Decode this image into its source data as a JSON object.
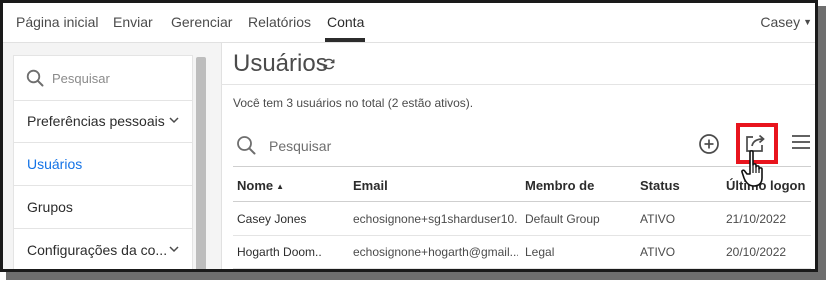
{
  "nav": {
    "items": [
      {
        "label": "Página inicial"
      },
      {
        "label": "Enviar"
      },
      {
        "label": "Gerenciar"
      },
      {
        "label": "Relatórios"
      },
      {
        "label": "Conta"
      }
    ],
    "active": "Conta",
    "user": "Casey"
  },
  "sidebar": {
    "search_placeholder": "Pesquisar",
    "items": [
      {
        "label": "Preferências pessoais",
        "icon": "chevron-down-icon"
      },
      {
        "label": "Usuários",
        "active": true
      },
      {
        "label": "Grupos"
      },
      {
        "label": "Configurações da co..."
      }
    ]
  },
  "main": {
    "title": "Usuários",
    "summary": "Você tem 3 usuários no total (2 estão ativos).",
    "search_placeholder": "Pesquisar",
    "table": {
      "columns": [
        "Nome",
        "Email",
        "Membro de",
        "Status",
        "Último logon"
      ],
      "sort_column": "Nome",
      "sort_direction": "ascending",
      "rows": [
        {
          "name": "Casey Jones",
          "email": "echosignone+sg1sharduser10...",
          "group": "Default Group",
          "status": "ATIVO",
          "last_logon": "21/10/2022"
        },
        {
          "name": "Hogarth Doom..",
          "email": "echosignone+hogarth@gmail....",
          "group": "Legal",
          "status": "ATIVO",
          "last_logon": "20/10/2022"
        }
      ]
    }
  },
  "colors": {
    "accent": "#1473e6",
    "highlight": "#e8141d",
    "text": "#2c2c2c",
    "sidebar_bg": "#f4f4f4"
  }
}
